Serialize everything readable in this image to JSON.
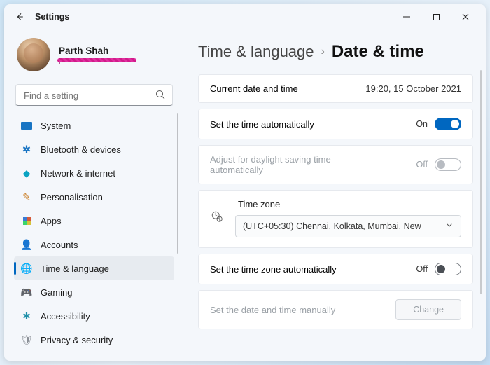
{
  "window": {
    "title": "Settings"
  },
  "profile": {
    "name": "Parth Shah",
    "email_redacted": "p"
  },
  "search": {
    "placeholder": "Find a setting"
  },
  "nav": {
    "items": [
      {
        "label": "System",
        "icon": "system"
      },
      {
        "label": "Bluetooth & devices",
        "icon": "bluetooth"
      },
      {
        "label": "Network & internet",
        "icon": "network"
      },
      {
        "label": "Personalisation",
        "icon": "personalisation"
      },
      {
        "label": "Apps",
        "icon": "apps"
      },
      {
        "label": "Accounts",
        "icon": "accounts"
      },
      {
        "label": "Time & language",
        "icon": "time"
      },
      {
        "label": "Gaming",
        "icon": "gaming"
      },
      {
        "label": "Accessibility",
        "icon": "accessibility"
      },
      {
        "label": "Privacy & security",
        "icon": "privacy"
      }
    ],
    "selected_index": 6
  },
  "breadcrumb": {
    "parent": "Time & language",
    "page": "Date & time"
  },
  "settings": {
    "current": {
      "label": "Current date and time",
      "value": "19:20, 15 October 2021"
    },
    "auto_time": {
      "label": "Set the time automatically",
      "state_text": "On",
      "on": true
    },
    "dst": {
      "label": "Adjust for daylight saving time automatically",
      "state_text": "Off",
      "on": false,
      "disabled": true
    },
    "timezone": {
      "label": "Time zone",
      "selected": "(UTC+05:30) Chennai, Kolkata, Mumbai, New"
    },
    "auto_tz": {
      "label": "Set the time zone automatically",
      "state_text": "Off",
      "on": false
    },
    "manual": {
      "label": "Set the date and time manually",
      "button": "Change",
      "disabled": true
    }
  }
}
